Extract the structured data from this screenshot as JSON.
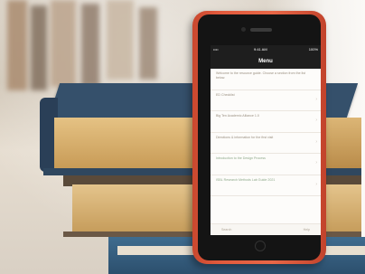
{
  "phone_screen": {
    "status": {
      "carrier": "•••• ",
      "time": "9:41 AM",
      "battery": "100%"
    },
    "title": "Menu",
    "items": [
      {
        "text": "Welcome to the resource guide. Choose a section from the list below."
      },
      {
        "text": "ED Checklist"
      },
      {
        "text": "Big Ten Academic Alliance 1.0"
      },
      {
        "text": "Directions & information for the first visit"
      },
      {
        "text": "Introduction to the Design Process"
      },
      {
        "text": "ISBL Research Methods Lab Guide 2021"
      }
    ],
    "tabs": {
      "left": "Search",
      "right": "Help"
    }
  },
  "colors": {
    "phone_case": "#e25a3c",
    "book_cover": "#334d68",
    "pages": "#d9b06a"
  },
  "icons": [
    "chevron-right-icon",
    "home-button"
  ]
}
